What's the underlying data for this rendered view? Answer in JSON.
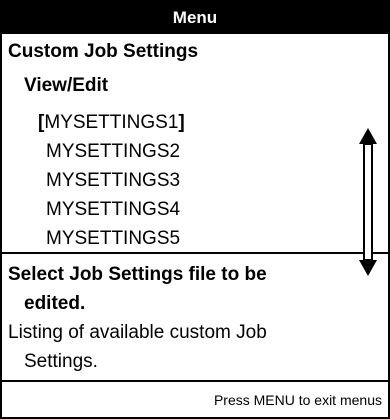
{
  "header": {
    "title": "Menu"
  },
  "menu": {
    "title": "Custom Job Settings",
    "subtitle": "View/Edit",
    "items": [
      {
        "label": "MYSETTINGS1",
        "selected": true,
        "open_bracket": "[",
        "close_bracket": "]"
      },
      {
        "label": "MYSETTINGS2",
        "selected": false
      },
      {
        "label": "MYSETTINGS3",
        "selected": false
      },
      {
        "label": "MYSETTINGS4",
        "selected": false
      },
      {
        "label": "MYSETTINGS5",
        "selected": false
      }
    ],
    "scroll_icon": "double-arrow-updown-icon"
  },
  "help": {
    "title_line1": "Select Job Settings file to be",
    "title_line2": "edited.",
    "body_line1": "Listing of available custom Job",
    "body_line2": "Settings."
  },
  "footer": {
    "hint": "Press MENU to exit menus"
  },
  "colors": {
    "foreground": "#000000",
    "background": "#ffffff"
  }
}
